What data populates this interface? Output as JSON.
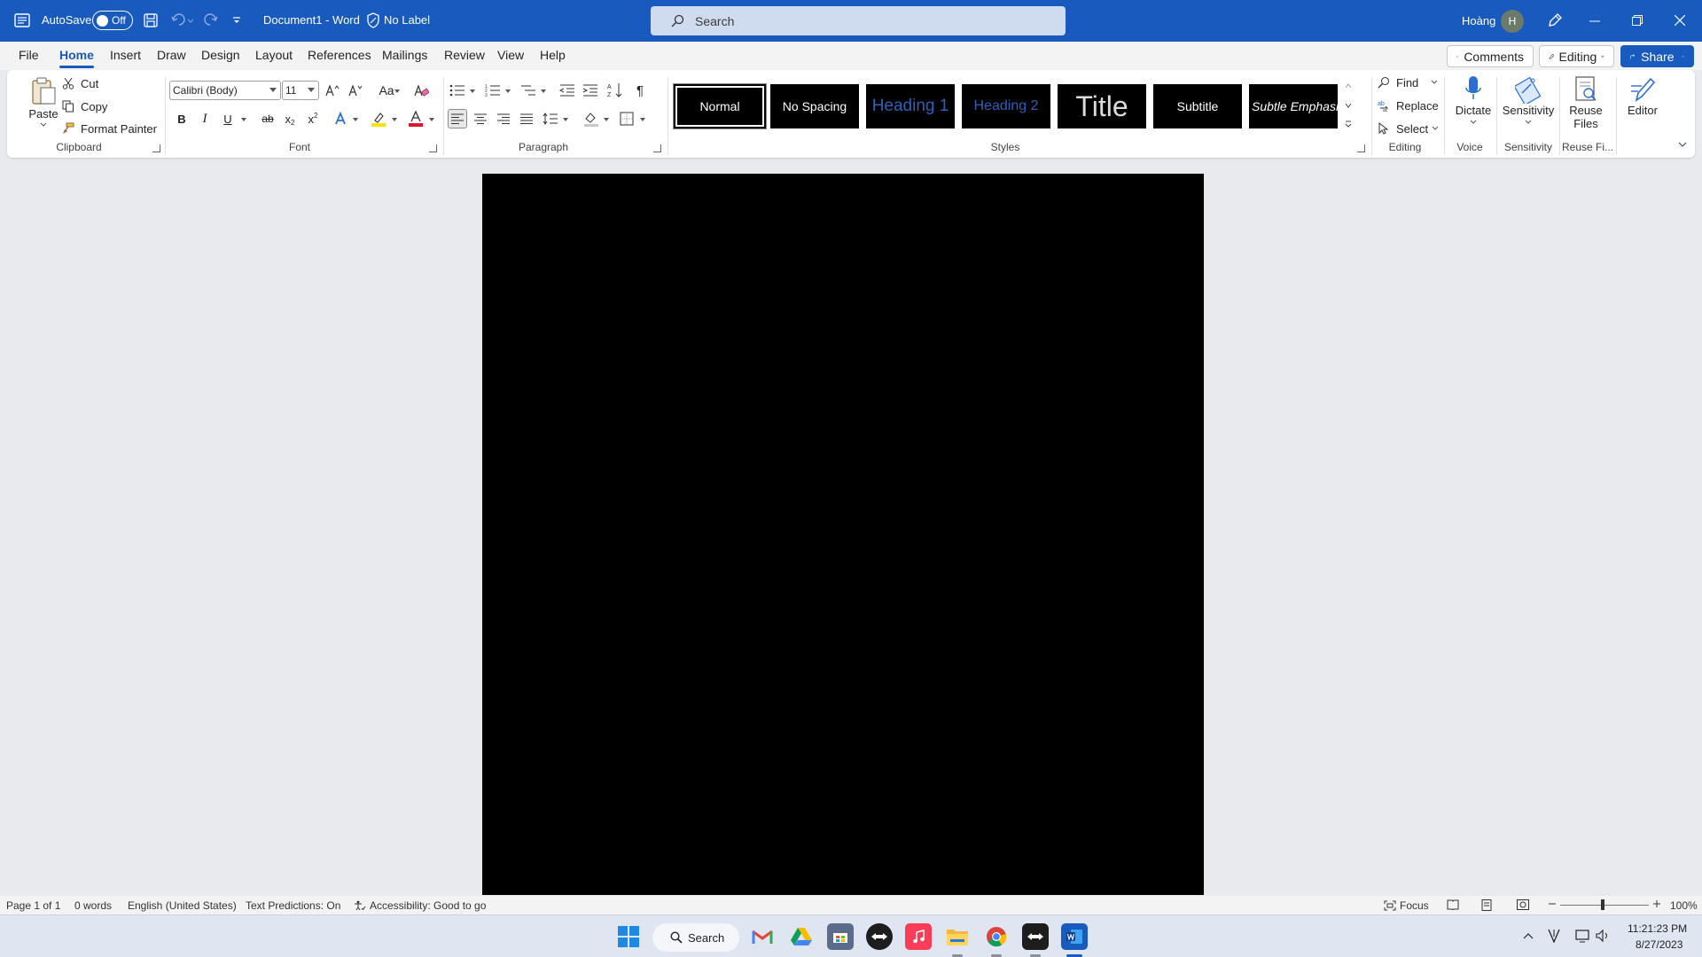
{
  "titlebar": {
    "autosave_label": "AutoSave",
    "autosave_state": "Off",
    "document_title": "Document1  -  Word",
    "label_text": "No Label",
    "search_placeholder": "Search",
    "user_name": "Hoàng",
    "user_initial": "H"
  },
  "menu": {
    "tabs": [
      "File",
      "Home",
      "Insert",
      "Draw",
      "Design",
      "Layout",
      "References",
      "Mailings",
      "Review",
      "View",
      "Help"
    ],
    "active_tab": "Home",
    "comments_label": "Comments",
    "editing_label": "Editing",
    "share_label": "Share"
  },
  "ribbon": {
    "clipboard": {
      "paste": "Paste",
      "cut": "Cut",
      "copy": "Copy",
      "format_painter": "Format Painter",
      "group_label": "Clipboard"
    },
    "font": {
      "font_name": "Calibri (Body)",
      "font_size": "11",
      "change_case": "Aa",
      "bold": "B",
      "italic": "I",
      "underline": "U",
      "strikethrough": "ab",
      "subscript": "x",
      "superscript": "x",
      "group_label": "Font"
    },
    "paragraph": {
      "group_label": "Paragraph",
      "pilcrow": "¶"
    },
    "styles": {
      "items": [
        "Normal",
        "No Spacing",
        "Heading 1",
        "Heading 2",
        "Title",
        "Subtitle",
        "Subtle Emphasis"
      ],
      "group_label": "Styles"
    },
    "editing": {
      "find": "Find",
      "replace": "Replace",
      "select": "Select",
      "group_label": "Editing"
    },
    "voice": {
      "dictate": "Dictate",
      "group_label": "Voice"
    },
    "sensitivity": {
      "button": "Sensitivity",
      "group_label": "Sensitivity"
    },
    "reuse": {
      "button_line1": "Reuse",
      "button_line2": "Files",
      "group_label": "Reuse Fi..."
    },
    "editor": {
      "button": "Editor"
    }
  },
  "statusbar": {
    "page": "Page 1 of 1",
    "words": "0 words",
    "language": "English (United States)",
    "predictions": "Text Predictions: On",
    "accessibility": "Accessibility: Good to go",
    "focus": "Focus",
    "zoom": "100%"
  },
  "taskbar": {
    "search_label": "Search",
    "time": "11:21:23 PM",
    "date": "8/27/2023"
  },
  "colors": {
    "accent": "#185abd",
    "page": "#000000",
    "canvas": "#e8eaee"
  }
}
